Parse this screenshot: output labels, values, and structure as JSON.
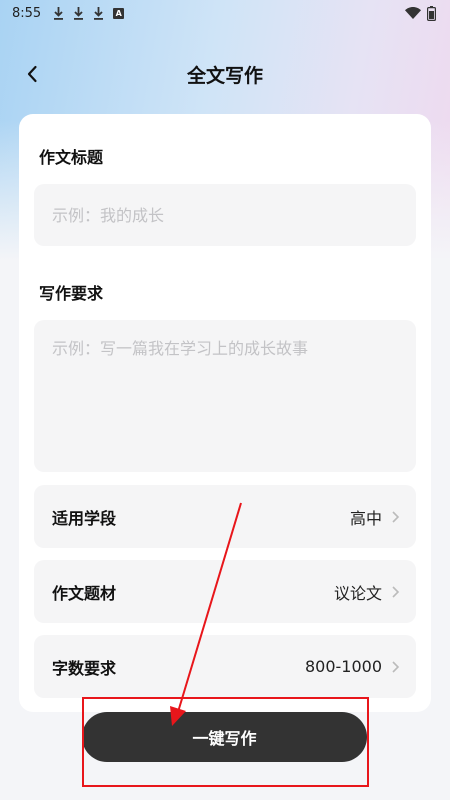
{
  "status_bar": {
    "time": "8:55",
    "left_icons": [
      "download-icon",
      "download-icon",
      "download-icon",
      "a-notification-icon"
    ],
    "a_glyph": "A",
    "right_icons": [
      "wifi-icon",
      "battery-icon"
    ]
  },
  "header": {
    "title": "全文写作"
  },
  "form": {
    "title_label": "作文标题",
    "title_placeholder": "示例：我的成长",
    "requirement_label": "写作要求",
    "requirement_placeholder": "示例：写一篇我在学习上的成长故事",
    "options": [
      {
        "label": "适用学段",
        "value": "高中"
      },
      {
        "label": "作文题材",
        "value": "议论文"
      },
      {
        "label": "字数要求",
        "value": "800-1000"
      }
    ]
  },
  "action": {
    "button_label": "一键写作"
  },
  "annotation": {
    "color": "#e8161b"
  }
}
